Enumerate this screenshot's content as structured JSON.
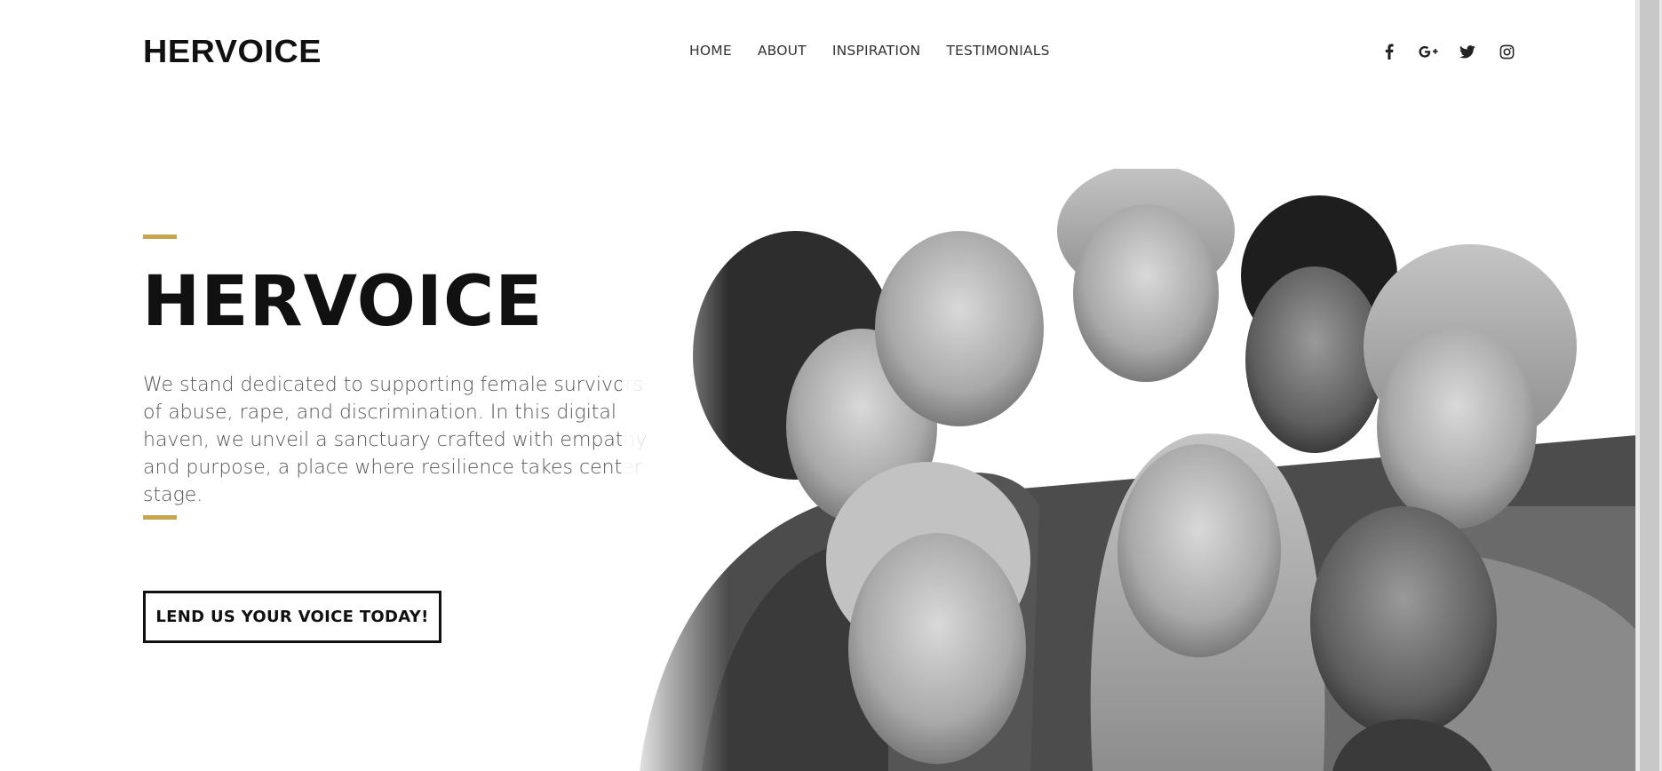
{
  "brand": {
    "logo_text": "HERVOICE"
  },
  "nav": {
    "items": [
      {
        "label": "HOME"
      },
      {
        "label": "ABOUT"
      },
      {
        "label": "INSPIRATION"
      },
      {
        "label": "TESTIMONIALS"
      }
    ]
  },
  "social": {
    "icons": [
      "facebook-icon",
      "google-plus-icon",
      "twitter-icon",
      "instagram-icon"
    ]
  },
  "hero": {
    "title": "HERVOICE",
    "description": "We stand dedicated to supporting female survivors of abuse, rape, and discrimination. In this digital haven, we unveil a sanctuary crafted with empathy and purpose, a place where resilience takes center stage.",
    "cta_label": "LEND US YOUR VOICE TODAY!"
  },
  "colors": {
    "accent": "#c9a54e",
    "text_dark": "#111111",
    "text_body": "#555555",
    "background": "#ffffff"
  },
  "image": {
    "subject": "group-portrait"
  }
}
